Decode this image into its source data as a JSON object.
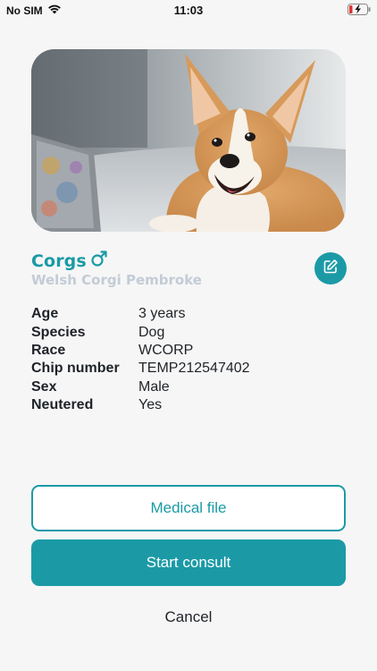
{
  "status_bar": {
    "carrier": "No SIM",
    "wifi_icon": "wifi-icon",
    "time": "11:03",
    "battery_icon": "battery-charging-icon"
  },
  "hero": {
    "image": "corgi-dog-photo"
  },
  "pet": {
    "name": "Corgs",
    "sex_icon": "male-symbol-icon",
    "breed": "Welsh Corgi Pembroke",
    "edit_icon": "edit-icon"
  },
  "details": [
    {
      "label": "Age",
      "value": "3 years"
    },
    {
      "label": "Species",
      "value": "Dog"
    },
    {
      "label": "Race",
      "value": "WCORP"
    },
    {
      "label": "Chip number",
      "value": "TEMP212547402"
    },
    {
      "label": "Sex",
      "value": "Male"
    },
    {
      "label": "Neutered",
      "value": "Yes"
    }
  ],
  "actions": {
    "medical_file": "Medical file",
    "start_consult": "Start consult",
    "cancel": "Cancel"
  },
  "colors": {
    "accent": "#1b9aa6",
    "breed_text": "#c3ccd6",
    "background": "#f6f6f6"
  }
}
